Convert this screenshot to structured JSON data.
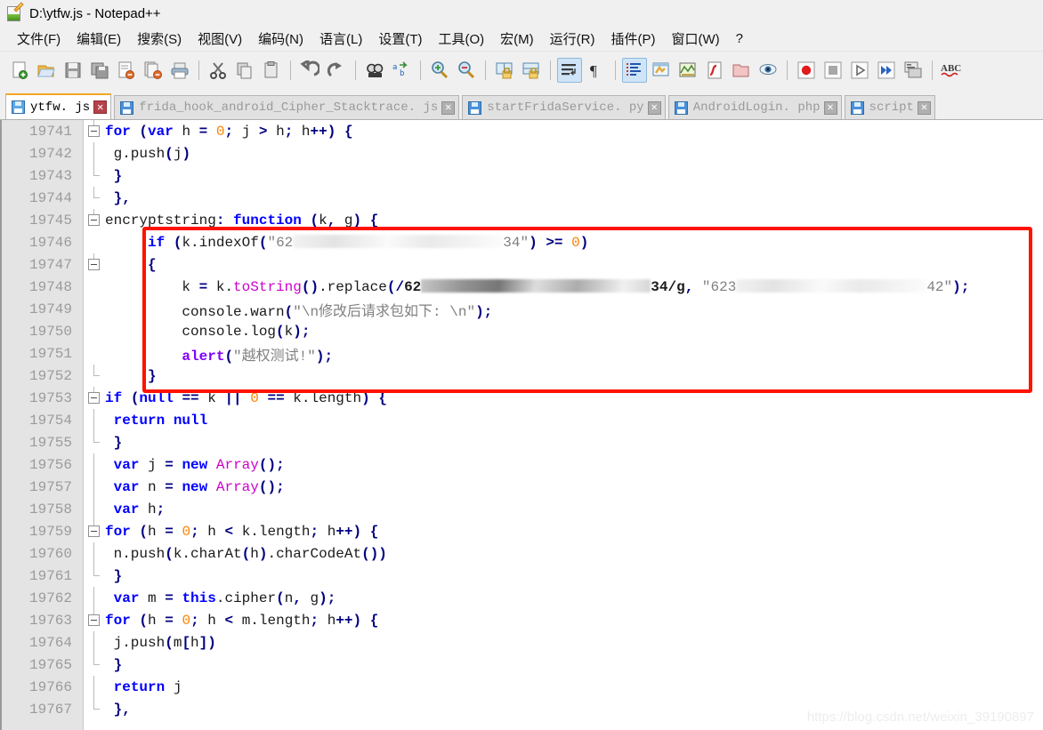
{
  "window": {
    "title": "D:\\ytfw.js - Notepad++",
    "icon": "notepad-plus-plus-icon"
  },
  "menu": {
    "items": [
      {
        "label": "文件(F)",
        "name": "menu-file"
      },
      {
        "label": "编辑(E)",
        "name": "menu-edit"
      },
      {
        "label": "搜索(S)",
        "name": "menu-search"
      },
      {
        "label": "视图(V)",
        "name": "menu-view"
      },
      {
        "label": "编码(N)",
        "name": "menu-encoding"
      },
      {
        "label": "语言(L)",
        "name": "menu-language"
      },
      {
        "label": "设置(T)",
        "name": "menu-settings"
      },
      {
        "label": "工具(O)",
        "name": "menu-tools"
      },
      {
        "label": "宏(M)",
        "name": "menu-macro"
      },
      {
        "label": "运行(R)",
        "name": "menu-run"
      },
      {
        "label": "插件(P)",
        "name": "menu-plugins"
      },
      {
        "label": "窗口(W)",
        "name": "menu-window"
      },
      {
        "label": "?",
        "name": "menu-help"
      }
    ]
  },
  "toolbar": {
    "buttons": [
      {
        "icon": "new-file-icon",
        "active": false
      },
      {
        "icon": "open-file-icon",
        "active": false
      },
      {
        "icon": "save-icon",
        "active": false
      },
      {
        "icon": "save-all-icon",
        "active": false
      },
      {
        "icon": "close-file-icon",
        "active": false
      },
      {
        "icon": "close-all-files-icon",
        "active": false
      },
      {
        "icon": "print-icon",
        "active": false
      },
      {
        "sep": true
      },
      {
        "icon": "cut-icon",
        "active": false
      },
      {
        "icon": "copy-icon",
        "active": false
      },
      {
        "icon": "paste-icon",
        "active": false
      },
      {
        "sep": true
      },
      {
        "icon": "undo-icon",
        "active": false
      },
      {
        "icon": "redo-icon",
        "active": false
      },
      {
        "sep": true
      },
      {
        "icon": "find-icon",
        "active": false
      },
      {
        "icon": "replace-icon",
        "active": false
      },
      {
        "sep": true
      },
      {
        "icon": "zoom-in-icon",
        "active": false
      },
      {
        "icon": "zoom-out-icon",
        "active": false
      },
      {
        "sep": true
      },
      {
        "icon": "sync-vertical-scroll-icon",
        "active": false
      },
      {
        "icon": "sync-horizontal-scroll-icon",
        "active": false
      },
      {
        "sep": true
      },
      {
        "icon": "word-wrap-icon",
        "active": true
      },
      {
        "icon": "show-all-characters-icon",
        "active": false
      },
      {
        "sep": true
      },
      {
        "icon": "indent-guide-icon",
        "active": true
      },
      {
        "icon": "user-defined-dialog-icon",
        "active": false
      },
      {
        "icon": "document-map-icon",
        "active": false
      },
      {
        "icon": "function-list-icon",
        "active": false
      },
      {
        "icon": "folder-as-workspace-icon",
        "active": false
      },
      {
        "icon": "monitoring-icon",
        "active": false
      },
      {
        "sep": true
      },
      {
        "icon": "record-macro-icon",
        "active": false
      },
      {
        "icon": "stop-macro-icon",
        "active": false
      },
      {
        "icon": "play-macro-icon",
        "active": false
      },
      {
        "icon": "run-macro-multiple-icon",
        "active": false
      },
      {
        "icon": "save-macro-icon",
        "active": false
      },
      {
        "sep": true
      },
      {
        "icon": "spell-check-icon",
        "active": false
      }
    ]
  },
  "tabs": [
    {
      "label": "ytfw. js",
      "active": true,
      "name": "tab-ytfw-js"
    },
    {
      "label": "frida_hook_android_Cipher_Stacktrace. js",
      "active": false,
      "name": "tab-frida-hook-android-cipher-stacktrace-js"
    },
    {
      "label": "startFridaService. py",
      "active": false,
      "name": "tab-startfridaservice-py"
    },
    {
      "label": "AndroidLogin. php",
      "active": false,
      "name": "tab-androidlogin-php"
    },
    {
      "label": "script",
      "active": false,
      "name": "tab-script"
    }
  ],
  "editor": {
    "first_line_number": 19741,
    "lines": [
      {
        "no": "19741",
        "fold": "open",
        "html": "<span class=\"kw\">for</span> <span class=\"op\">(</span><span class=\"kw\">var</span> h <span class=\"op\">=</span> <span class=\"num\">0</span><span class=\"op\">;</span> j <span class=\"op\">&gt;</span> h<span class=\"op\">;</span> h<span class=\"op\">++)</span> <span class=\"op\">{</span>"
      },
      {
        "no": "19742",
        "fold": "line",
        "html": " g.push<span class=\"op\">(</span>j<span class=\"op\">)</span>"
      },
      {
        "no": "19743",
        "fold": "tick",
        "html": " <span class=\"op\">}</span>"
      },
      {
        "no": "19744",
        "fold": "tick",
        "html": " <span class=\"op\">}</span><span class=\"op\">,</span>"
      },
      {
        "no": "19745",
        "fold": "open",
        "html": "encryptstring<span class=\"op\">:</span> <span class=\"kw\">function</span> <span class=\"op\">(</span>k<span class=\"op\">,</span> g<span class=\"op\">)</span> <span class=\"op\">{</span>"
      },
      {
        "no": "19746",
        "fold": "none",
        "html": "     <span class=\"kw\">if</span> <span class=\"op\">(</span>k.indexOf<span class=\"op\">(</span><span class=\"str\">\"62</span>@@REDACT_A@@<span class=\"str\">34\"</span><span class=\"op\">)</span> <span class=\"op\">&gt;=</span> <span class=\"num\">0</span><span class=\"op\">)</span>"
      },
      {
        "no": "19747",
        "fold": "open-plain",
        "html": "     <span class=\"op\">{</span>"
      },
      {
        "no": "19748",
        "fold": "none",
        "html": "         k <span class=\"op\">=</span> k.<span class=\"fn\">toString</span><span class=\"op\">()</span>.replace<span class=\"op\">(/</span><span class=\"bold\">62</span>@@REDACT_B@@<span class=\"bold\">34/g</span><span class=\"op\">,</span> <span class=\"str\">\"623</span>@@REDACT_C@@<span class=\"str\">42\"</span><span class=\"op\">);</span>"
      },
      {
        "no": "19749",
        "fold": "none",
        "html": "         console.warn<span class=\"op\">(</span><span class=\"str\">\"\\n修改后请求包如下: \\n\"</span><span class=\"op\">);</span>"
      },
      {
        "no": "19750",
        "fold": "none",
        "html": "         console.log<span class=\"op\">(</span>k<span class=\"op\">);</span>"
      },
      {
        "no": "19751",
        "fold": "none",
        "html": "         <span class=\"kw2\">alert</span><span class=\"op\">(</span><span class=\"str\">\"越权测试!\"</span><span class=\"op\">);</span>"
      },
      {
        "no": "19752",
        "fold": "tick",
        "html": "     <span class=\"op\">}</span>"
      },
      {
        "no": "19753",
        "fold": "open",
        "html": "<span class=\"kw\">if</span> <span class=\"op\">(</span><span class=\"kw\">null</span> <span class=\"op\">==</span> k <span class=\"op\">||</span> <span class=\"num\">0</span> <span class=\"op\">==</span> k.length<span class=\"op\">)</span> <span class=\"op\">{</span>"
      },
      {
        "no": "19754",
        "fold": "line",
        "html": " <span class=\"kw\">return</span> <span class=\"kw\">null</span>"
      },
      {
        "no": "19755",
        "fold": "tick",
        "html": " <span class=\"op\">}</span>"
      },
      {
        "no": "19756",
        "fold": "line",
        "html": " <span class=\"kw\">var</span> j <span class=\"op\">=</span> <span class=\"kw\">new</span> <span class=\"fn\">Array</span><span class=\"op\">();</span>"
      },
      {
        "no": "19757",
        "fold": "line",
        "html": " <span class=\"kw\">var</span> n <span class=\"op\">=</span> <span class=\"kw\">new</span> <span class=\"fn\">Array</span><span class=\"op\">();</span>"
      },
      {
        "no": "19758",
        "fold": "line",
        "html": " <span class=\"kw\">var</span> h<span class=\"op\">;</span>"
      },
      {
        "no": "19759",
        "fold": "open",
        "html": "<span class=\"kw\">for</span> <span class=\"op\">(</span>h <span class=\"op\">=</span> <span class=\"num\">0</span><span class=\"op\">;</span> h <span class=\"op\">&lt;</span> k.length<span class=\"op\">;</span> h<span class=\"op\">++)</span> <span class=\"op\">{</span>"
      },
      {
        "no": "19760",
        "fold": "line",
        "html": " n.push<span class=\"op\">(</span>k.charAt<span class=\"op\">(</span>h<span class=\"op\">)</span>.charCodeAt<span class=\"op\">())</span>"
      },
      {
        "no": "19761",
        "fold": "tick",
        "html": " <span class=\"op\">}</span>"
      },
      {
        "no": "19762",
        "fold": "line",
        "html": " <span class=\"kw\">var</span> m <span class=\"op\">=</span> <span class=\"kw\">this</span>.cipher<span class=\"op\">(</span>n<span class=\"op\">,</span> g<span class=\"op\">);</span>"
      },
      {
        "no": "19763",
        "fold": "open",
        "html": "<span class=\"kw\">for</span> <span class=\"op\">(</span>h <span class=\"op\">=</span> <span class=\"num\">0</span><span class=\"op\">;</span> h <span class=\"op\">&lt;</span> m.length<span class=\"op\">;</span> h<span class=\"op\">++)</span> <span class=\"op\">{</span>"
      },
      {
        "no": "19764",
        "fold": "line",
        "html": " j.push<span class=\"op\">(</span>m<span class=\"op\">[</span>h<span class=\"op\">])</span>"
      },
      {
        "no": "19765",
        "fold": "tick",
        "html": " <span class=\"op\">}</span>"
      },
      {
        "no": "19766",
        "fold": "line",
        "html": " <span class=\"kw\">return</span> j"
      },
      {
        "no": "19767",
        "fold": "tick",
        "html": " <span class=\"op\">}</span><span class=\"op\">,</span>"
      }
    ],
    "annotation": {
      "type": "red-rectangle-highlight",
      "color": "#ff1200"
    }
  },
  "watermark": {
    "text": "https://blog.csdn.net/weixin_39190897"
  }
}
